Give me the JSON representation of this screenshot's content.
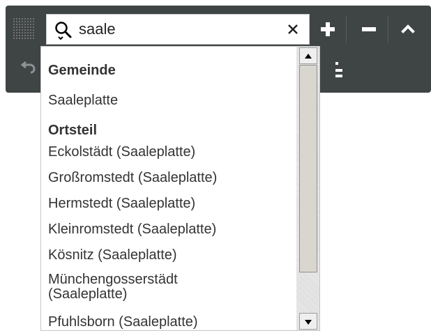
{
  "search": {
    "value": "saale",
    "clear_icon": "close-icon",
    "search_icon": "search-icon"
  },
  "toolbar": {
    "zoom_in_icon": "plus-icon",
    "zoom_out_icon": "minus-icon",
    "collapse_icon": "chevron-up-icon",
    "undo_icon": "undo-icon",
    "grid_icon": "grip-icon"
  },
  "dropdown": {
    "groups": [
      {
        "label": "Gemeinde",
        "items": [
          "Saaleplatte"
        ]
      },
      {
        "label": "Ortsteil",
        "items": [
          "Eckolstädt (Saaleplatte)",
          "Großromstedt (Saaleplatte)",
          "Hermstedt (Saaleplatte)",
          "Kleinromstedt (Saaleplatte)",
          "Kösnitz (Saaleplatte)",
          "Münchengosserstädt",
          "(Saaleplatte)",
          "Pfuhlsborn (Saaleplatte)"
        ]
      }
    ]
  },
  "colors": {
    "toolbar_bg": "#3f4445",
    "toolbar_icon": "#ffffff",
    "dropdown_bg": "#ffffff",
    "text": "#333333"
  }
}
